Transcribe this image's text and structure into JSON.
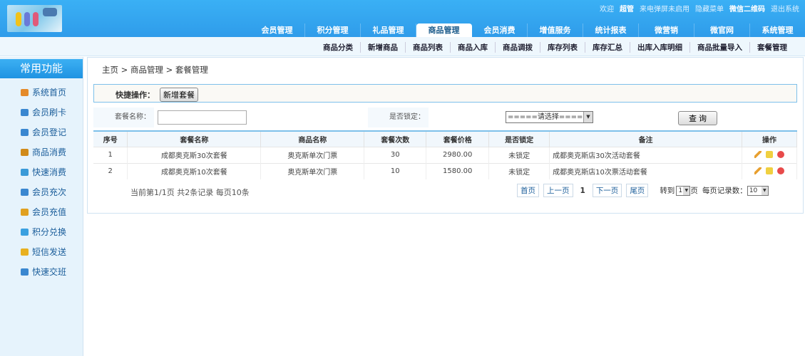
{
  "header": {
    "links": [
      "欢迎",
      "超管",
      "来电弹屏未启用",
      "隐藏菜单",
      "微信二维码",
      "退出系统"
    ],
    "tabs": [
      "会员管理",
      "积分管理",
      "礼品管理",
      "商品管理",
      "会员消费",
      "增值服务",
      "统计报表",
      "微营销",
      "微官网",
      "系统管理"
    ],
    "active_tab": 3
  },
  "subnav": [
    "商品分类",
    "新增商品",
    "商品列表",
    "商品入库",
    "商品调拨",
    "库存列表",
    "库存汇总",
    "出库入库明细",
    "商品批量导入",
    "套餐管理"
  ],
  "sidebar": {
    "title": "常用功能",
    "items": [
      {
        "label": "系统首页",
        "color": "#e48a2a"
      },
      {
        "label": "会员刷卡",
        "color": "#3a87d0"
      },
      {
        "label": "会员登记",
        "color": "#3a87d0"
      },
      {
        "label": "商品消费",
        "color": "#d08a1a"
      },
      {
        "label": "快速消费",
        "color": "#3a9ad8"
      },
      {
        "label": "会员充次",
        "color": "#3a87d0"
      },
      {
        "label": "会员充值",
        "color": "#e0a020"
      },
      {
        "label": "积分兑换",
        "color": "#3aa0e0"
      },
      {
        "label": "短信发送",
        "color": "#e8b020"
      },
      {
        "label": "快速交班",
        "color": "#3a87d0"
      }
    ]
  },
  "breadcrumb": "主页  >  商品管理  >  套餐管理",
  "quick": {
    "label": "快捷操作：",
    "add": "新增套餐"
  },
  "search": {
    "name_label": "套餐名称：",
    "name_value": "",
    "lock_label": "是否锁定：",
    "lock_value": "=====请选择=====",
    "query": "查  询"
  },
  "table": {
    "headers": [
      "序号",
      "套餐名称",
      "商品名称",
      "套餐次数",
      "套餐价格",
      "是否锁定",
      "备注",
      "操作"
    ],
    "rows": [
      [
        "1",
        "成都奥克斯30次套餐",
        "奥克斯单次门票",
        "30",
        "2980.00",
        "未锁定",
        "成都奥克斯店30次活动套餐"
      ],
      [
        "2",
        "成都奥克斯10次套餐",
        "奥克斯单次门票",
        "10",
        "1580.00",
        "未锁定",
        "成都奥克斯店10次票活动套餐"
      ]
    ]
  },
  "pagination": {
    "info": "当前第1/1页 共2条记录 每页10条",
    "first": "首页",
    "prev": "上一页",
    "current": "1",
    "next": "下一页",
    "last": "尾页",
    "goto": "转到",
    "page_val": "1",
    "page_unit": "页",
    "per_label": "每页记录数：",
    "per_val": "10"
  }
}
